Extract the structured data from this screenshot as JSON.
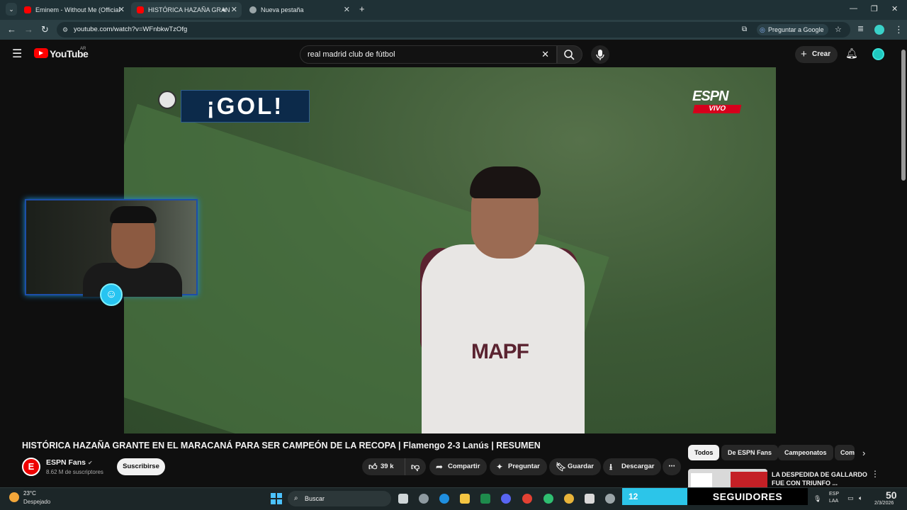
{
  "browser": {
    "tabs": [
      {
        "label": "Eminem - Without Me (Official",
        "active": false
      },
      {
        "label": "HISTÓRICA HAZAÑA GRAN",
        "active": true
      },
      {
        "label": "Nueva pestaña",
        "active": false
      }
    ],
    "new_tab_label": "+",
    "url": "youtube.com/watch?v=WFnbkwTzOfg",
    "ask_google_label": "Preguntar a Google"
  },
  "youtube": {
    "logo_text": "YouTube",
    "country_code": "AR",
    "search_value": "real madrid club de fútbol",
    "create_label": "Crear"
  },
  "video": {
    "gol_text": "¡GOL!",
    "broadcaster": "ESPN",
    "live_label": "VIVO",
    "shirt_text": "MAPF"
  },
  "details": {
    "title": "HISTÓRICA HAZAÑA GRANTE EN EL MARACANÁ PARA SER CAMPEÓN DE LA RECOPA | Flamengo 2-3 Lanús | RESUMEN",
    "channel_name": "ESPN Fans",
    "channel_initial": "E",
    "subscribers": "8.62 M de suscriptores",
    "subscribe_label": "Suscribirse",
    "likes": "39 k",
    "share_label": "Compartir",
    "ask_label": "Preguntar",
    "save_label": "Guardar",
    "download_label": "Descargar"
  },
  "sidebar": {
    "chips": [
      "Todos",
      "De ESPN Fans",
      "Campeonatos",
      "Com"
    ],
    "rec_title": "LA DESPEDIDA DE GALLARDO FUE CON TRIUNFO ..."
  },
  "taskbar": {
    "temperature": "23°C",
    "weather": "Despejado",
    "search_placeholder": "Buscar",
    "followers_count": "12",
    "followers_label": "SEGUIDORES",
    "lang_top": "ESP",
    "lang_bottom": "LAA",
    "clock_partial": "50",
    "date_partial": "2/3/2026"
  },
  "colors": {
    "accent_red": "#ff0000",
    "followers_cyan": "#2cc5e9",
    "espn_red": "#d6001c"
  }
}
